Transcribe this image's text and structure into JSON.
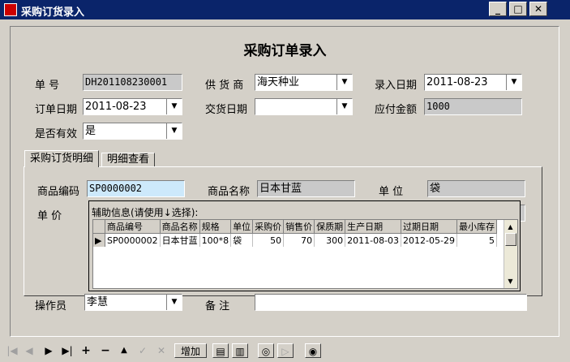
{
  "window": {
    "title": "采购订货录入"
  },
  "form": {
    "title": "采购订单录入",
    "order_no": {
      "label": "单    号",
      "value": "DH201108230001"
    },
    "supplier": {
      "label": "供 货 商",
      "value": "海天种业"
    },
    "entry_date": {
      "label": "录入日期",
      "value": "2011-08-23"
    },
    "order_date": {
      "label": "订单日期",
      "value": "2011-08-23"
    },
    "delivery_date": {
      "label": "交货日期",
      "value": ""
    },
    "amount_due": {
      "label": "应付金额",
      "value": "1000"
    },
    "is_valid": {
      "label": "是否有效",
      "value": "是"
    }
  },
  "tabs": [
    {
      "label": "采购订货明细",
      "active": true
    },
    {
      "label": "明细查看",
      "active": false
    }
  ],
  "detail": {
    "product_code": {
      "label": "商品编码",
      "value": "SP0000002"
    },
    "product_name": {
      "label": "商品名称",
      "value": "日本甘蓝"
    },
    "unit": {
      "label": "单    位",
      "value": "袋"
    },
    "price": {
      "label": "单    价"
    }
  },
  "popup": {
    "title": "辅助信息(请使用↓选择):",
    "columns": [
      "商品编号",
      "商品名称",
      "规格",
      "单位",
      "采购价",
      "销售价",
      "保质期",
      "生产日期",
      "过期日期",
      "最小库存"
    ],
    "rows": [
      [
        "SP0000002",
        "日本甘蓝",
        "100*8",
        "袋",
        "50",
        "70",
        "300",
        "2011-08-03",
        "2012-05-29",
        "5"
      ]
    ]
  },
  "footer": {
    "operator": {
      "label": "操作员",
      "value": "李慧"
    },
    "remark": {
      "label": "备    注",
      "value": ""
    }
  },
  "navbar": {
    "first": "|◀",
    "prior": "◀",
    "next": "▶",
    "last": "▶|",
    "insert": "+",
    "delete": "−",
    "edit": "▲",
    "post": "✓",
    "cancel": "✕",
    "add_label": "增加"
  }
}
